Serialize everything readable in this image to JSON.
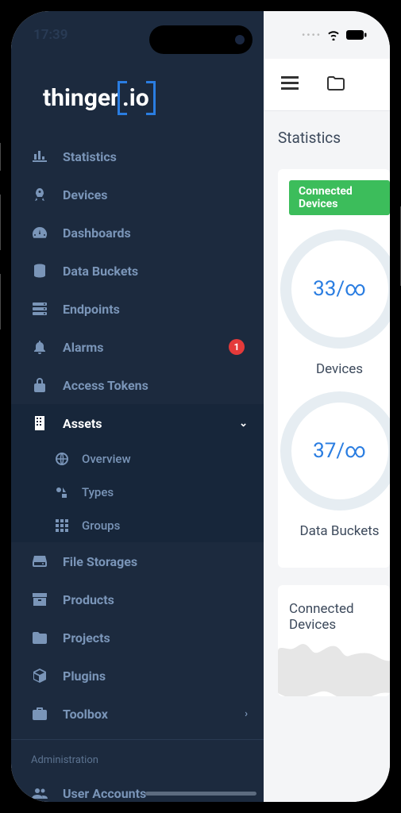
{
  "status_bar": {
    "time": "17:39"
  },
  "logo": {
    "prefix": "thinger",
    "suffix": ".io"
  },
  "sidebar": {
    "items": [
      {
        "label": "Statistics"
      },
      {
        "label": "Devices"
      },
      {
        "label": "Dashboards"
      },
      {
        "label": "Data Buckets"
      },
      {
        "label": "Endpoints"
      },
      {
        "label": "Alarms",
        "badge": "1"
      },
      {
        "label": "Access Tokens"
      },
      {
        "label": "Assets"
      },
      {
        "label": "File Storages"
      },
      {
        "label": "Products"
      },
      {
        "label": "Projects"
      },
      {
        "label": "Plugins"
      },
      {
        "label": "Toolbox"
      }
    ],
    "assets_submenu": [
      {
        "label": "Overview"
      },
      {
        "label": "Types"
      },
      {
        "label": "Groups"
      }
    ],
    "section_header": "Administration",
    "admin_items": [
      {
        "label": "User Accounts"
      }
    ]
  },
  "main": {
    "page_title": "Statistics",
    "connected_badge": "Connected Devices",
    "gauges": [
      {
        "value": "33/∞",
        "label": "Devices"
      },
      {
        "value": "37/∞",
        "label": "Data Buckets"
      }
    ],
    "card2_title": "Connected Devices"
  }
}
